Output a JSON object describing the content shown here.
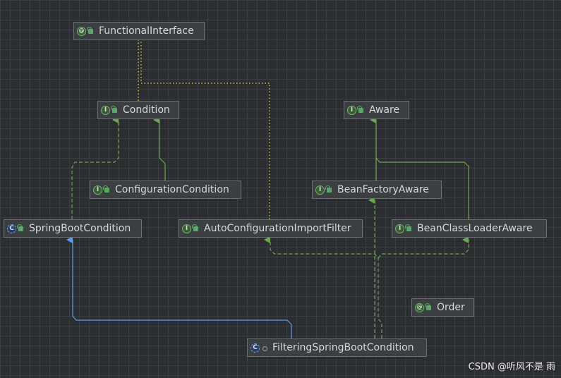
{
  "diagram": {
    "nodes": [
      {
        "id": "functional_interface",
        "label": "FunctionalInterface",
        "kind": "annotation",
        "kind_glyph": "@",
        "visibility": "public"
      },
      {
        "id": "condition",
        "label": "Condition",
        "kind": "interface",
        "kind_glyph": "I",
        "visibility": "public"
      },
      {
        "id": "aware",
        "label": "Aware",
        "kind": "interface",
        "kind_glyph": "I",
        "visibility": "public"
      },
      {
        "id": "configuration_condition",
        "label": "ConfigurationCondition",
        "kind": "interface",
        "kind_glyph": "I",
        "visibility": "public"
      },
      {
        "id": "bean_factory_aware",
        "label": "BeanFactoryAware",
        "kind": "interface",
        "kind_glyph": "I",
        "visibility": "public"
      },
      {
        "id": "spring_boot_condition",
        "label": "SpringBootCondition",
        "kind": "abstract-class",
        "kind_glyph": "C",
        "visibility": "public"
      },
      {
        "id": "auto_configuration_import_filter",
        "label": "AutoConfigurationImportFilter",
        "kind": "interface",
        "kind_glyph": "I",
        "visibility": "public"
      },
      {
        "id": "bean_class_loader_aware",
        "label": "BeanClassLoaderAware",
        "kind": "interface",
        "kind_glyph": "I",
        "visibility": "public"
      },
      {
        "id": "order",
        "label": "Order",
        "kind": "annotation",
        "kind_glyph": "@",
        "visibility": "public"
      },
      {
        "id": "filtering_spring_boot_condition",
        "label": "FilteringSpringBootCondition",
        "kind": "abstract-class",
        "kind_glyph": "C",
        "visibility": "package"
      }
    ],
    "edges": [
      {
        "from": "condition",
        "to": "functional_interface",
        "type": "annotated-by"
      },
      {
        "from": "auto_configuration_import_filter",
        "to": "functional_interface",
        "type": "annotated-by"
      },
      {
        "from": "configuration_condition",
        "to": "condition",
        "type": "extends"
      },
      {
        "from": "spring_boot_condition",
        "to": "condition",
        "type": "implements"
      },
      {
        "from": "bean_factory_aware",
        "to": "aware",
        "type": "extends"
      },
      {
        "from": "bean_class_loader_aware",
        "to": "aware",
        "type": "extends"
      },
      {
        "from": "filtering_spring_boot_condition",
        "to": "spring_boot_condition",
        "type": "extends"
      },
      {
        "from": "filtering_spring_boot_condition",
        "to": "auto_configuration_import_filter",
        "type": "implements"
      },
      {
        "from": "filtering_spring_boot_condition",
        "to": "bean_factory_aware",
        "type": "implements"
      },
      {
        "from": "filtering_spring_boot_condition",
        "to": "bean_class_loader_aware",
        "type": "implements"
      }
    ]
  },
  "colors": {
    "background": "#2b2d30",
    "extends_interface": "#6aa84f",
    "implements": "#6aa84f",
    "extends_class": "#5d9cec",
    "annotation_link": "#c7c33d"
  },
  "watermark": "CSDN @听风不是 雨"
}
